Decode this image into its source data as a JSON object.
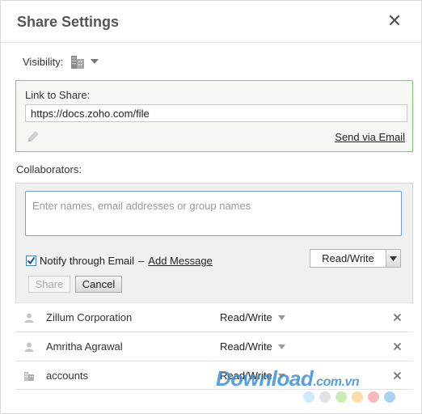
{
  "dialog": {
    "title": "Share Settings",
    "close_icon": "close-icon"
  },
  "visibility": {
    "label": "Visibility:",
    "icon": "building-icon"
  },
  "link": {
    "label": "Link to Share:",
    "url": "https://docs.zoho.com/file",
    "send_email": "Send via Email",
    "edit_icon": "pencil-icon"
  },
  "collaborators": {
    "label": "Collaborators:",
    "input_placeholder": "Enter names, email addresses or group names",
    "notify_label": "Notify through Email",
    "notify_separator": "–",
    "notify_checked": true,
    "add_message": "Add Message",
    "permission": "Read/Write",
    "share_button": "Share",
    "cancel_button": "Cancel",
    "list": [
      {
        "name": "Zillum Corporation",
        "permission": "Read/Write",
        "icon": "user-icon"
      },
      {
        "name": "Amritha Agrawal",
        "permission": "Read/Write",
        "icon": "user-icon"
      },
      {
        "name": "accounts",
        "permission": "Read/Write",
        "icon": "group-icon"
      }
    ]
  },
  "watermark": {
    "text": "Download",
    "suffix": ".com.vn",
    "dot_colors": [
      "#bfe3f5",
      "#d9d9d9",
      "#b9e59a",
      "#f8d28a",
      "#f4a3a3",
      "#8ec4ef"
    ]
  },
  "colors": {
    "link_box_border": "#7fc87a",
    "input_focus_border": "#6f9fd8",
    "checkbox_accent": "#4a7ebb"
  }
}
